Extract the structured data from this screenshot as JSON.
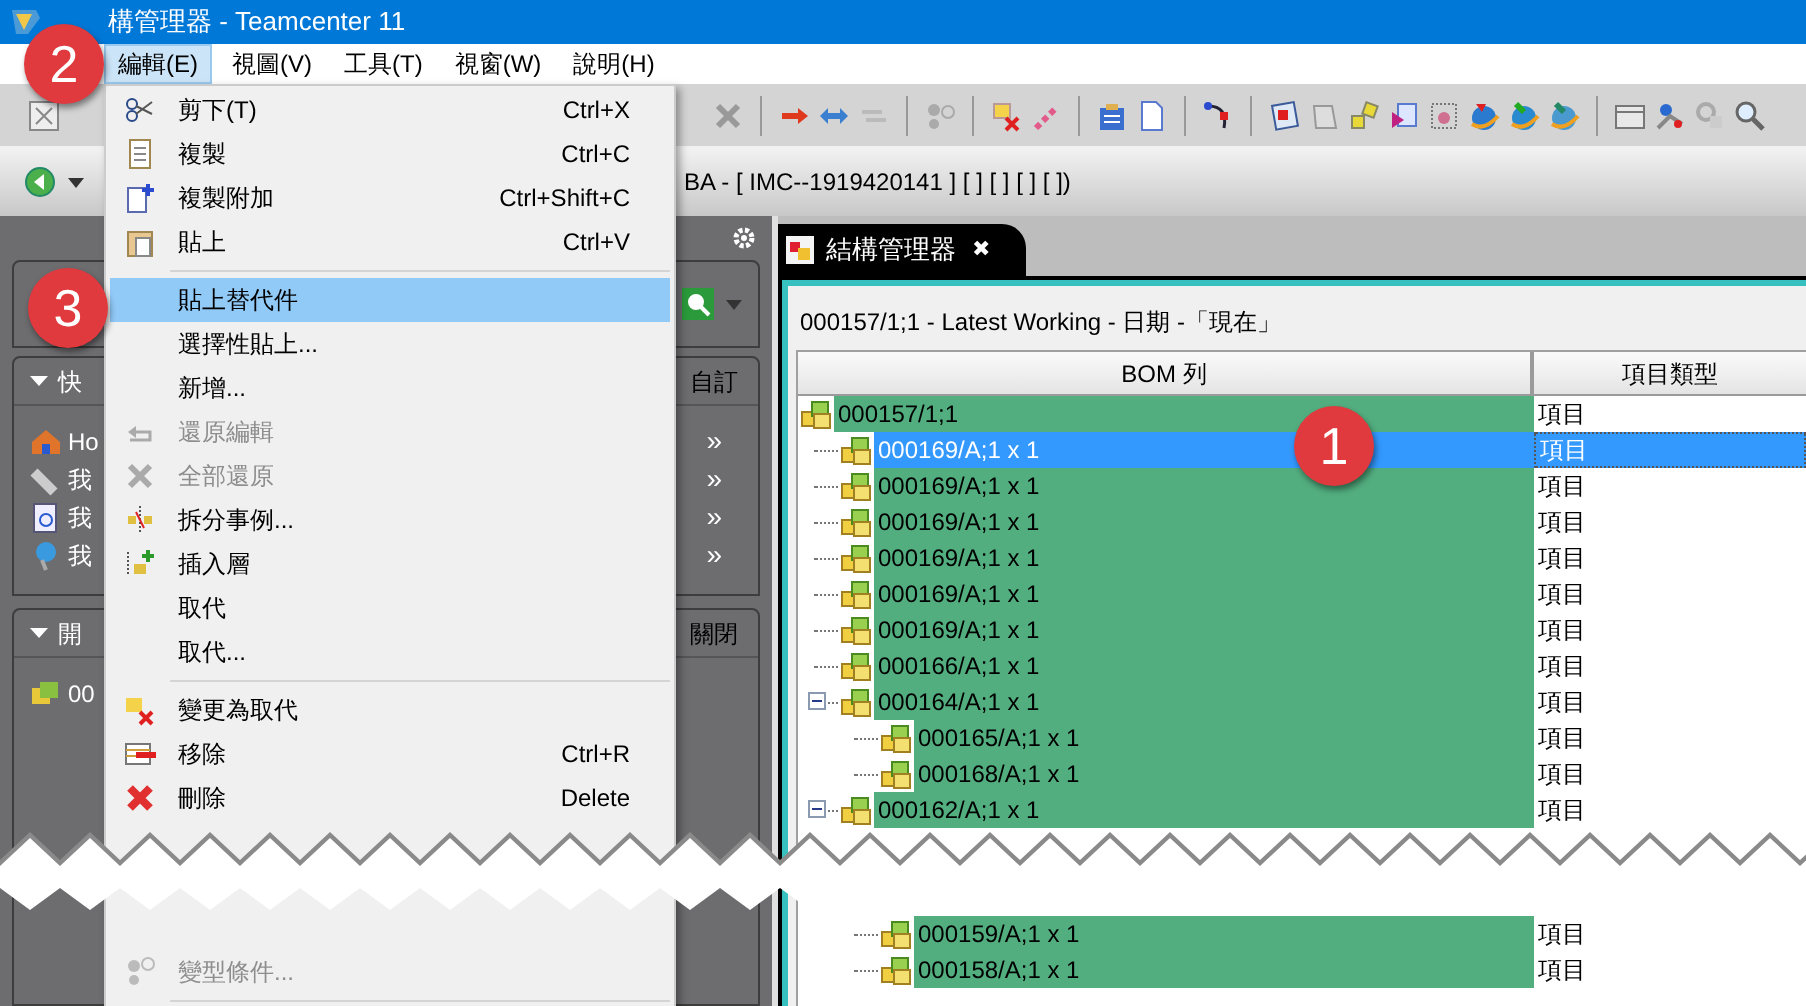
{
  "window": {
    "title": "構管理器 - Teamcenter 11"
  },
  "menu_bar": [
    {
      "label": "編輯(E)",
      "selected": true
    },
    {
      "label": "視圖(V)",
      "selected": false
    },
    {
      "label": "工具(T)",
      "selected": false
    },
    {
      "label": "視窗(W)",
      "selected": false
    },
    {
      "label": "說明(H)",
      "selected": false
    }
  ],
  "address_bar": {
    "text": "BA - [ IMC--1919420141 ] [ ] [ ] [ ]  [ ])"
  },
  "left_panel": {
    "sections": [
      {
        "title": "快",
        "action": "自訂",
        "items": [
          {
            "label": "Ho",
            "arrow": "»"
          },
          {
            "label": "我",
            "arrow": "»"
          },
          {
            "label": "我",
            "arrow": "»"
          },
          {
            "label": "我",
            "arrow": "»"
          }
        ]
      },
      {
        "title": "開",
        "action": "關閉",
        "items": [
          {
            "label": "00"
          }
        ]
      }
    ]
  },
  "edit_menu": [
    {
      "kind": "item",
      "label": "剪下(T)",
      "shortcut": "Ctrl+X",
      "selected": false,
      "disabled": false
    },
    {
      "kind": "item",
      "label": "複製",
      "shortcut": "Ctrl+C",
      "selected": false,
      "disabled": false
    },
    {
      "kind": "item",
      "label": "複製附加",
      "shortcut": "Ctrl+Shift+C",
      "selected": false,
      "disabled": false
    },
    {
      "kind": "item",
      "label": "貼上",
      "shortcut": "Ctrl+V",
      "selected": false,
      "disabled": false
    },
    {
      "kind": "separator"
    },
    {
      "kind": "item",
      "label": "貼上替代件",
      "selected": true,
      "disabled": false
    },
    {
      "kind": "item",
      "label": "選擇性貼上...",
      "selected": false,
      "disabled": false
    },
    {
      "kind": "item",
      "label": "新增...",
      "selected": false,
      "disabled": false
    },
    {
      "kind": "item",
      "label": "還原編輯",
      "selected": false,
      "disabled": true
    },
    {
      "kind": "item",
      "label": "全部還原",
      "selected": false,
      "disabled": true
    },
    {
      "kind": "item",
      "label": "拆分事例...",
      "selected": false,
      "disabled": false
    },
    {
      "kind": "item",
      "label": "插入層",
      "selected": false,
      "disabled": false
    },
    {
      "kind": "item",
      "label": "取代",
      "selected": false,
      "disabled": false
    },
    {
      "kind": "item",
      "label": "取代...",
      "selected": false,
      "disabled": false
    },
    {
      "kind": "separator"
    },
    {
      "kind": "item",
      "label": "變更為取代",
      "selected": false,
      "disabled": false
    },
    {
      "kind": "item",
      "label": "移除",
      "shortcut": "Ctrl+R",
      "selected": false,
      "disabled": false
    },
    {
      "kind": "item",
      "label": "刪除",
      "shortcut": "Delete",
      "selected": false,
      "disabled": false
    },
    {
      "kind": "gap"
    },
    {
      "kind": "item",
      "label": "變型條件...",
      "selected": false,
      "disabled": true
    },
    {
      "kind": "separator"
    }
  ],
  "editor_tab": {
    "label": "結構管理器",
    "close": "✖"
  },
  "context_line": "000157/1;1 - Latest Working - 日期 -「現在」",
  "table": {
    "columns": [
      "BOM 列",
      "項目類型"
    ],
    "tree": [
      {
        "kind": "node",
        "label": "000157/1;1",
        "type": "項目",
        "selected": false,
        "children": [
          {
            "kind": "node",
            "label": "000169/A;1 x 1",
            "type": "項目",
            "selected": true
          },
          {
            "kind": "node",
            "label": "000169/A;1 x 1",
            "type": "項目",
            "selected": false
          },
          {
            "kind": "node",
            "label": "000169/A;1 x 1",
            "type": "項目",
            "selected": false
          },
          {
            "kind": "node",
            "label": "000169/A;1 x 1",
            "type": "項目",
            "selected": false
          },
          {
            "kind": "node",
            "label": "000169/A;1 x 1",
            "type": "項目",
            "selected": false
          },
          {
            "kind": "node",
            "label": "000169/A;1 x 1",
            "type": "項目",
            "selected": false
          },
          {
            "kind": "node",
            "label": "000166/A;1 x 1",
            "type": "項目",
            "selected": false
          },
          {
            "kind": "node",
            "label": "000164/A;1 x 1",
            "type": "項目",
            "selected": false,
            "expanded": true,
            "children": [
              {
                "kind": "node",
                "label": "000165/A;1 x 1",
                "type": "項目",
                "selected": false
              },
              {
                "kind": "node",
                "label": "000168/A;1 x 1",
                "type": "項目",
                "selected": false
              }
            ]
          },
          {
            "kind": "node",
            "label": "000162/A;1 x 1",
            "type": "項目",
            "selected": false,
            "expanded": true,
            "children": [
              {
                "kind": "gap"
              },
              {
                "kind": "node",
                "label": "000159/A;1 x 1",
                "type": "項目",
                "selected": false
              },
              {
                "kind": "node",
                "label": "000158/A;1 x 1",
                "type": "項目",
                "selected": false
              }
            ]
          }
        ]
      }
    ]
  },
  "callouts": [
    {
      "label": "1"
    },
    {
      "label": "2"
    },
    {
      "label": "3"
    }
  ]
}
